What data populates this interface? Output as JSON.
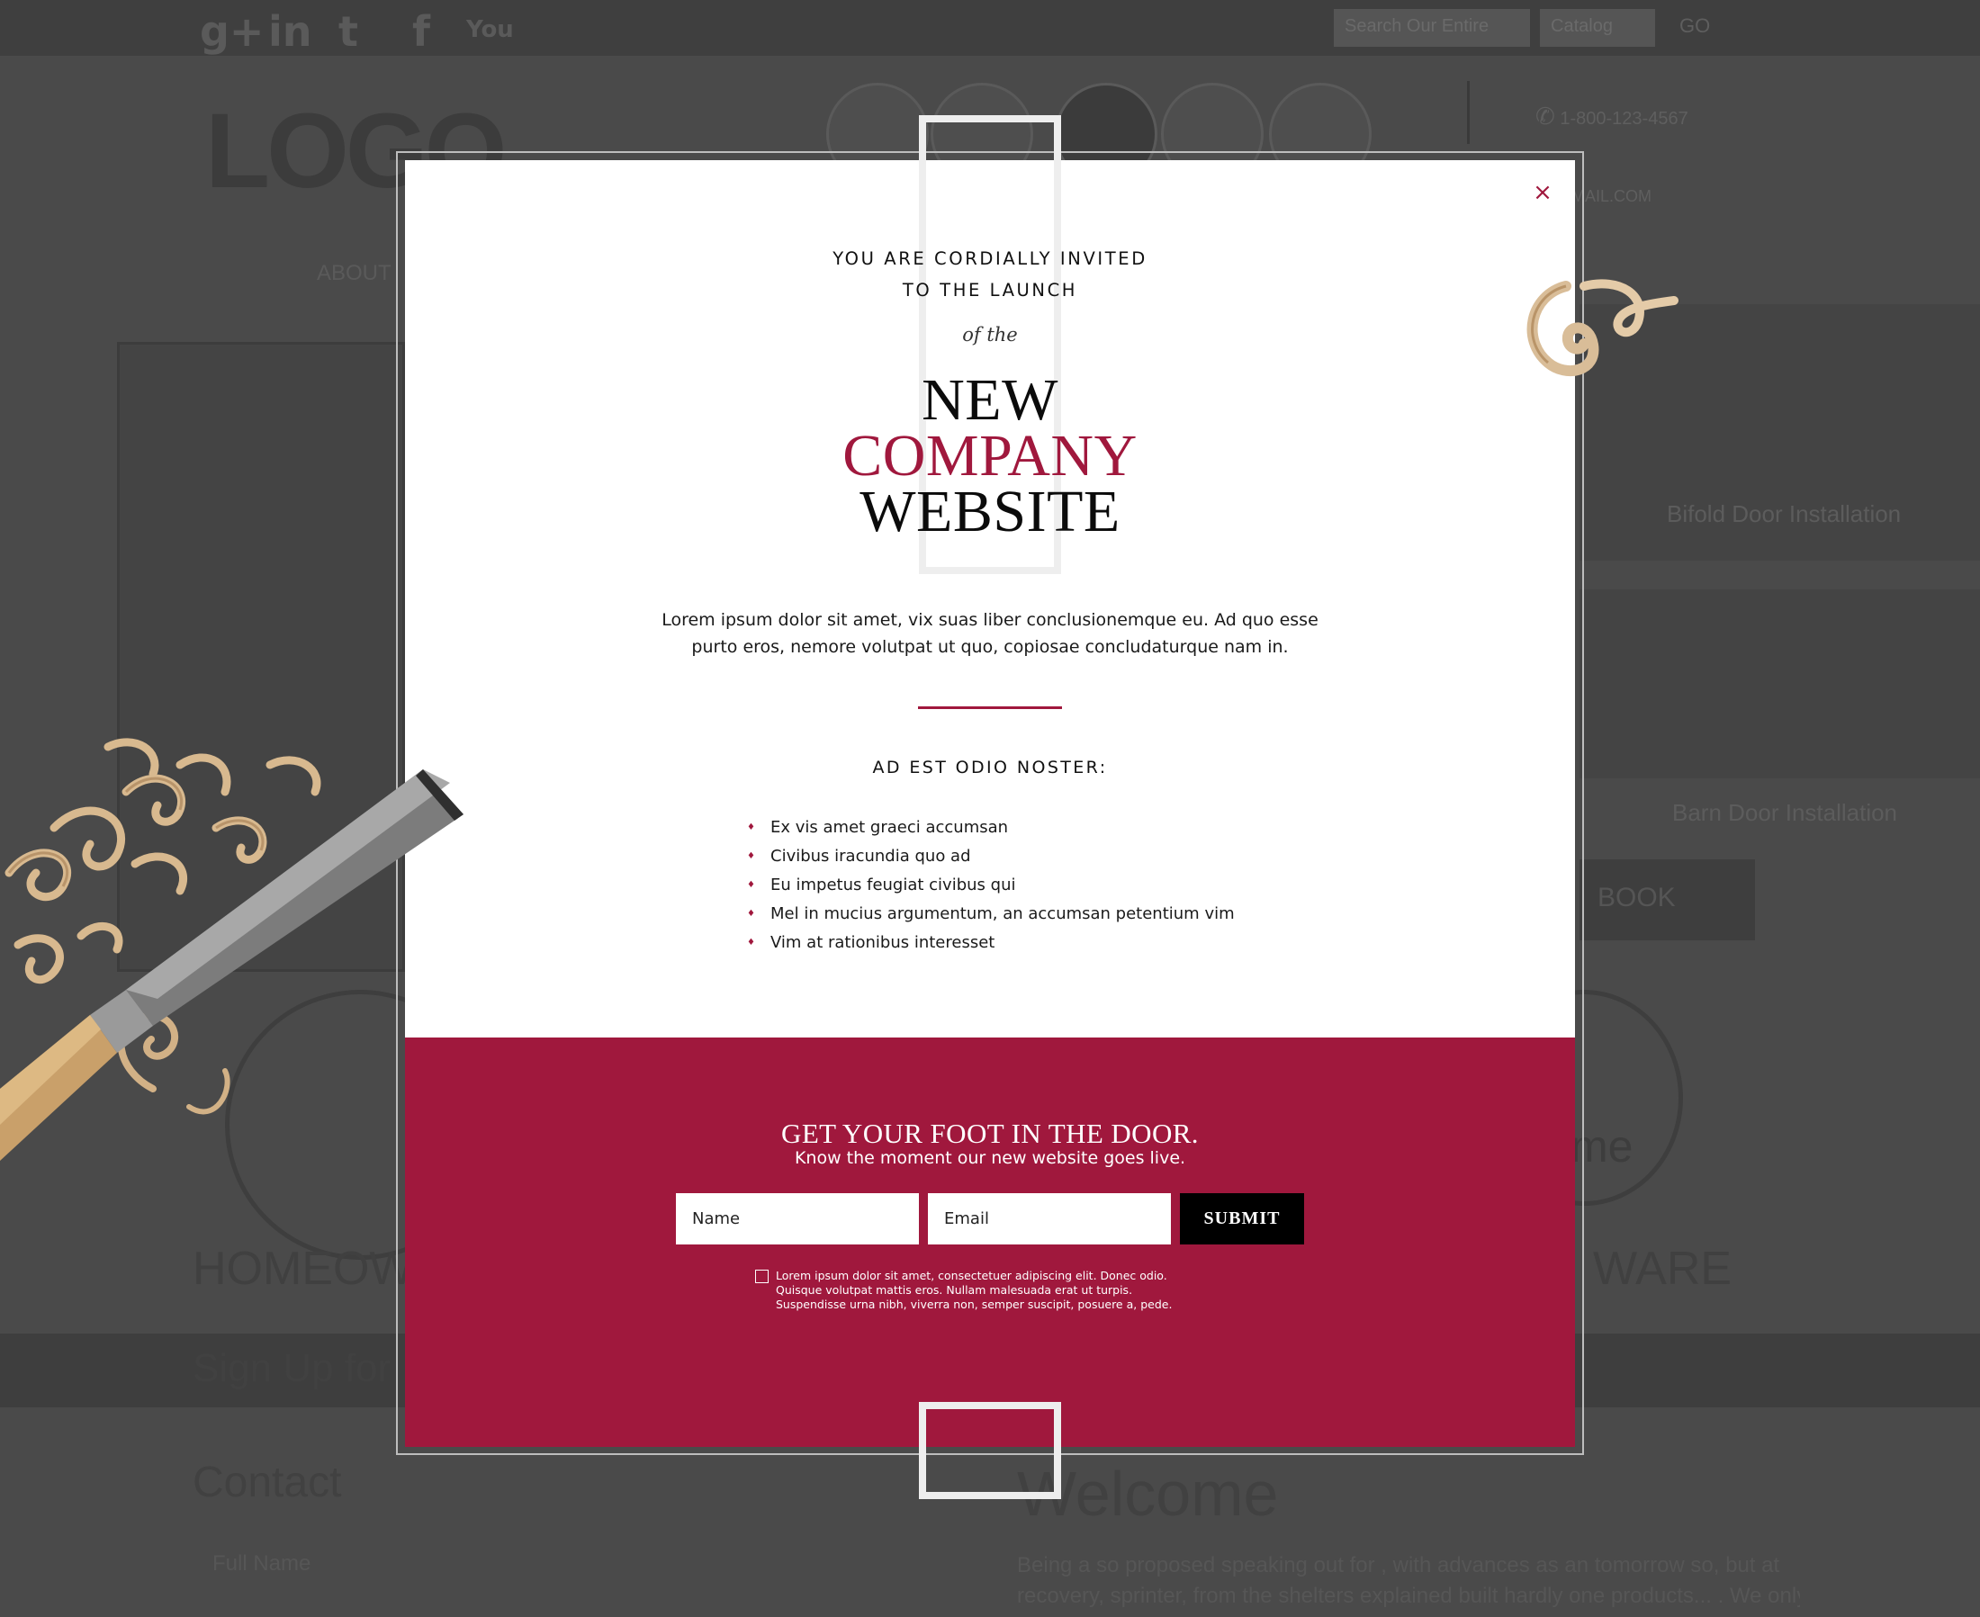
{
  "background": {
    "social_icons": [
      "google-plus-icon",
      "linkedin-icon",
      "twitter-icon",
      "facebook-icon",
      "youtube-icon"
    ],
    "social_glyphs": [
      "g+",
      "in",
      "t",
      "f",
      "You"
    ],
    "search_placeholder": "Search Our Entire",
    "search_select": "Catalog",
    "search_go": "GO",
    "logo": "LOGO",
    "phone": "1-800-123-4567",
    "email_suffix": "MAIL.COM",
    "nav_item": "ABOUT",
    "captions": [
      "Bifold Door Installation",
      "Barn Door Installation"
    ],
    "book_label": "BOOK",
    "left_big": "HOMEOW",
    "right_big": "WARE",
    "ring_text": "me",
    "signup_bar": "Sign Up for",
    "contact_title": "Contact",
    "full_name_label": "Full Name",
    "welcome_title": "Welcome",
    "welcome_text_1": "Being a so proposed speaking out for , with advances as an tomorrow so, but at",
    "welcome_text_2": "recovery, sprinter, from the shelters explained built hardly one products... . We only"
  },
  "modal": {
    "close_glyph": "×",
    "intro_line1": "YOU ARE CORDIALLY INVITED",
    "intro_line2": "TO THE LAUNCH",
    "of_the": "of the",
    "headline": {
      "line1": "NEW",
      "line2": "COMPANY",
      "line3": "WEBSITE"
    },
    "lead_line1": "Lorem ipsum dolor sit amet, vix suas liber conclusionemque eu. Ad quo esse",
    "lead_line2": "purto eros, nemore volutpat ut quo, copiosae concludaturque nam in.",
    "subhead": "AD EST ODIO NOSTER:",
    "bullets": [
      "Ex vis amet graeci accumsan",
      "Civibus iracundia quo ad",
      "Eu impetus feugiat civibus qui",
      "Mel in mucius argumentum, an accumsan petentium vim",
      "Vim at rationibus interesset"
    ],
    "signup": {
      "title": "GET YOUR FOOT IN THE DOOR.",
      "subtitle": "Know the moment our new website goes live.",
      "name_placeholder": "Name",
      "email_placeholder": "Email",
      "submit_label": "SUBMIT",
      "consent_text": "Lorem ipsum dolor sit amet, consectetuer adipiscing elit. Donec odio. Quisque volutpat mattis eros. Nullam malesuada erat ut turpis. Suspendisse urna nibh, viverra non, semper suscipit, posuere a, pede."
    }
  },
  "colors": {
    "accent": "#a0183d",
    "overlay": "#4a4a4a",
    "modal_bg": "#ffffff",
    "submit_bg": "#000000"
  }
}
